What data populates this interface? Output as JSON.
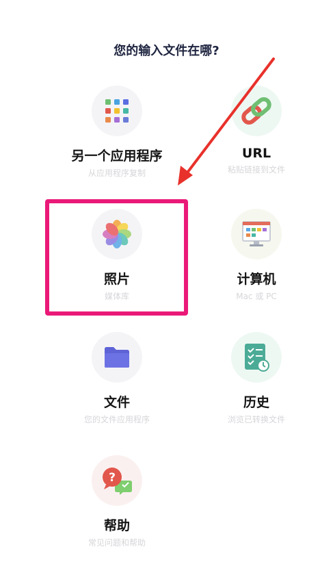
{
  "title": "您的输入文件在哪?",
  "options": [
    {
      "label": "另一个应用程序",
      "sub": "从应用程序复制",
      "icon": "apps-grid-icon"
    },
    {
      "label": "URL",
      "sub": "粘贴链接到文件",
      "icon": "link-icon"
    },
    {
      "label": "照片",
      "sub": "媒体库",
      "icon": "photos-icon"
    },
    {
      "label": "计算机",
      "sub": "Mac 或 PC",
      "icon": "computer-icon"
    },
    {
      "label": "文件",
      "sub": "您的文件应用程序",
      "icon": "folder-icon"
    },
    {
      "label": "历史",
      "sub": "浏览已转换文件",
      "icon": "history-icon"
    },
    {
      "label": "帮助",
      "sub": "常见问题和帮助",
      "icon": "help-icon"
    }
  ],
  "colors": {
    "highlight": "#ea1978",
    "arrow": "#e8312b",
    "title": "#1f2540"
  }
}
